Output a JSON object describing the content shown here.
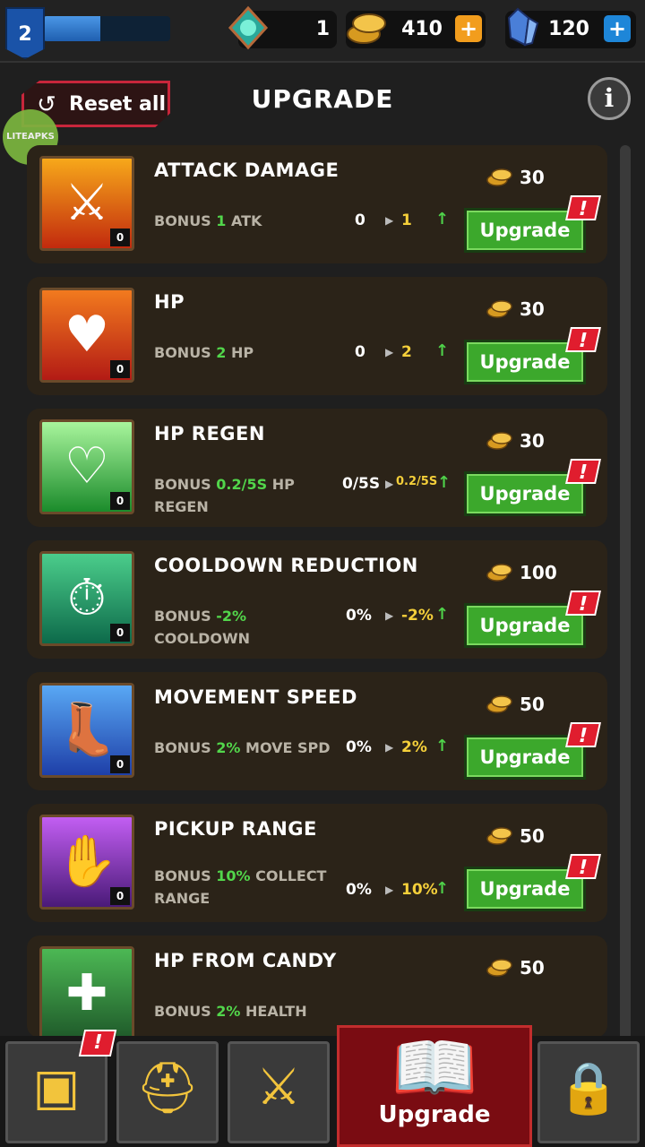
{
  "header": {
    "level": "2",
    "xp_fraction": 0.45,
    "gems": "1",
    "coins": "410",
    "crystals": "120",
    "plus_label": "+"
  },
  "panel": {
    "reset_label": "Reset all",
    "title": "UPGRADE",
    "info_label": "i",
    "watermark": "LITEAPKS"
  },
  "upgrades": [
    {
      "title": "ATTACK DAMAGE",
      "bonus_pre": "BONUS ",
      "bonus_val": "1",
      "bonus_post": " ATK",
      "cur": "0",
      "next": "1",
      "cost": "30",
      "count": "0",
      "button": "Upgrade",
      "alert": "!"
    },
    {
      "title": "HP",
      "bonus_pre": "BONUS ",
      "bonus_val": "2",
      "bonus_post": " HP",
      "cur": "0",
      "next": "2",
      "cost": "30",
      "count": "0",
      "button": "Upgrade",
      "alert": "!"
    },
    {
      "title": "HP REGEN",
      "bonus_pre": "BONUS ",
      "bonus_val": "0.2/5S",
      "bonus_post": " HP REGEN",
      "cur": "0/5S",
      "next": "0.2/5S",
      "cost": "30",
      "count": "0",
      "button": "Upgrade",
      "alert": "!"
    },
    {
      "title": "COOLDOWN REDUCTION",
      "bonus_pre": "BONUS ",
      "bonus_val": "-2%",
      "bonus_post": " COOLDOWN",
      "cur": "0%",
      "next": "-2%",
      "cost": "100",
      "count": "0",
      "button": "Upgrade",
      "alert": "!"
    },
    {
      "title": "MOVEMENT SPEED",
      "bonus_pre": "BONUS ",
      "bonus_val": "2%",
      "bonus_post": " MOVE SPD",
      "cur": "0%",
      "next": "2%",
      "cost": "50",
      "count": "0",
      "button": "Upgrade",
      "alert": "!"
    },
    {
      "title": "PICKUP RANGE",
      "bonus_pre": "BONUS ",
      "bonus_val": "10%",
      "bonus_post": " COLLECT RANGE",
      "cur": "0%",
      "next": "10%",
      "cost": "50",
      "count": "0",
      "button": "Upgrade",
      "alert": "!"
    },
    {
      "title": "HP FROM CANDY",
      "bonus_pre": "BONUS ",
      "bonus_val": "2%",
      "bonus_post": " HEALTH",
      "cur": "",
      "next": "",
      "cost": "50",
      "count": "",
      "button": "",
      "alert": "!"
    }
  ],
  "nav": {
    "alert": "!",
    "active_label": "Upgrade"
  },
  "colors": {
    "accent_green": "#3ca82c",
    "bonus_green": "#52d64b",
    "next_gold": "#f4cf3a",
    "alert_red": "#e01d2e",
    "active_tab": "#7a0c12"
  }
}
